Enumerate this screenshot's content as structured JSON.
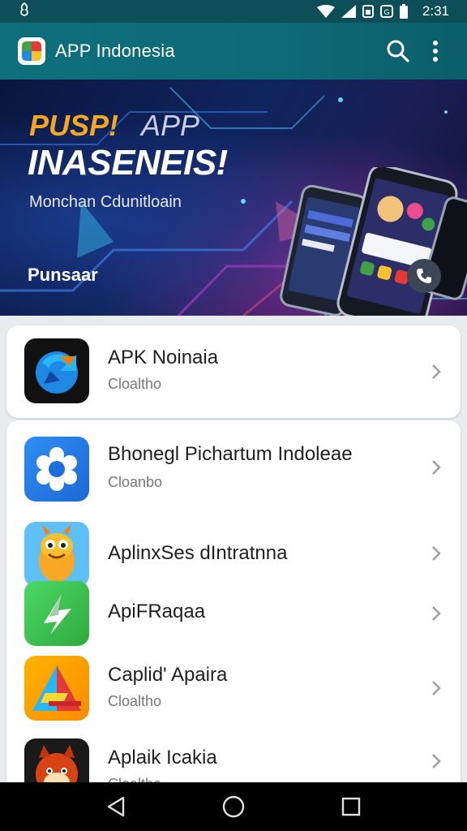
{
  "status_bar": {
    "time": "2:31",
    "left_icon": "notification-icon",
    "icons": [
      "wifi-icon",
      "signal-icon",
      "sim-icon",
      "data-icon",
      "battery-icon"
    ]
  },
  "app_bar": {
    "title": "APP Indonesia",
    "logo_icon": "app-logo-icon",
    "actions": [
      "search-icon",
      "more-vert-icon"
    ]
  },
  "banner": {
    "tag_1": "PUSP!",
    "tag_2": "APP",
    "headline": "INASENEIS!",
    "subtitle": "Monchan Cdunitloain",
    "cta": "Punsaar",
    "phone_icon": "phone-icon",
    "colors": {
      "accent": "#f5a623",
      "background": "#10245e"
    }
  },
  "featured": {
    "title": "APK Noinaia",
    "subtitle": "Cloaltho",
    "icon": "refresh-app-icon"
  },
  "list": [
    {
      "title": "Bhonegl Pichartum Indoleae",
      "subtitle": "Cloanbo",
      "icon": "gear-flower-app-icon"
    },
    {
      "title": "AplinxSes dIntratnna",
      "subtitle": "",
      "icon": "mascot-app-icon"
    },
    {
      "title": "ApiFRaqaa",
      "subtitle": "",
      "icon": "lightning-app-icon"
    },
    {
      "title": "Caplid' Apaira",
      "subtitle": "Cloaltho",
      "icon": "triangle-app-icon"
    },
    {
      "title": "Aplaik Icakia",
      "subtitle": "Cloaltho",
      "icon": "fox-app-icon"
    }
  ],
  "nav_bar": {
    "buttons": [
      "back-icon",
      "home-icon",
      "recents-icon"
    ]
  }
}
